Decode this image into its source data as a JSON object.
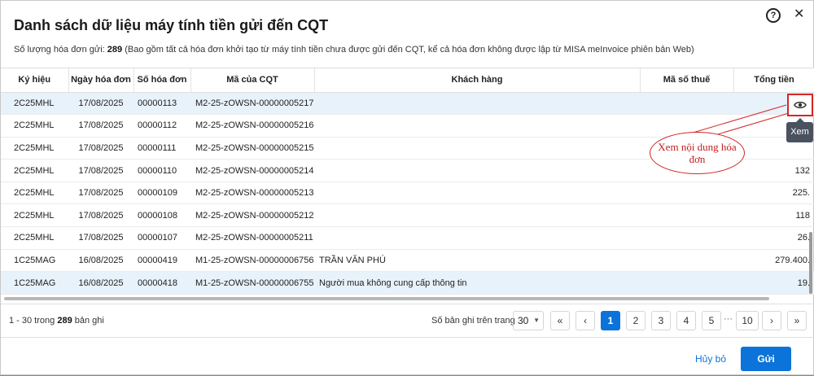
{
  "dialog": {
    "title": "Danh sách dữ liệu máy tính tiền gửi đến CQT",
    "help_icon_glyph": "?",
    "close_icon_glyph": "✕",
    "count_label": "Số lượng hóa đơn gửi: ",
    "count_value": "289",
    "count_note": " (Bao gồm tất cả hóa đơn khởi tạo từ máy tính tiền chưa được gửi đến CQT, kể cả hóa đơn không được lập từ MISA meInvoice phiên bản Web)"
  },
  "table": {
    "headers": [
      "Ký hiệu",
      "Ngày hóa đơn",
      "Số hóa đơn",
      "Mã của CQT",
      "Khách hàng",
      "Mã số thuế",
      "Tổng tiền"
    ],
    "rows": [
      {
        "ky_hieu": "2C25MHL",
        "ngay": "17/08/2025",
        "so": "00000113",
        "ma_cqt": "M2-25-zOWSN-00000005217",
        "khach_hang": "",
        "mst": "",
        "tong_tien": ""
      },
      {
        "ky_hieu": "2C25MHL",
        "ngay": "17/08/2025",
        "so": "00000112",
        "ma_cqt": "M2-25-zOWSN-00000005216",
        "khach_hang": "",
        "mst": "",
        "tong_tien": ""
      },
      {
        "ky_hieu": "2C25MHL",
        "ngay": "17/08/2025",
        "so": "00000111",
        "ma_cqt": "M2-25-zOWSN-00000005215",
        "khach_hang": "",
        "mst": "",
        "tong_tien": ""
      },
      {
        "ky_hieu": "2C25MHL",
        "ngay": "17/08/2025",
        "so": "00000110",
        "ma_cqt": "M2-25-zOWSN-00000005214",
        "khach_hang": "",
        "mst": "",
        "tong_tien": "132"
      },
      {
        "ky_hieu": "2C25MHL",
        "ngay": "17/08/2025",
        "so": "00000109",
        "ma_cqt": "M2-25-zOWSN-00000005213",
        "khach_hang": "",
        "mst": "",
        "tong_tien": "225."
      },
      {
        "ky_hieu": "2C25MHL",
        "ngay": "17/08/2025",
        "so": "00000108",
        "ma_cqt": "M2-25-zOWSN-00000005212",
        "khach_hang": "",
        "mst": "",
        "tong_tien": "118"
      },
      {
        "ky_hieu": "2C25MHL",
        "ngay": "17/08/2025",
        "so": "00000107",
        "ma_cqt": "M2-25-zOWSN-00000005211",
        "khach_hang": "",
        "mst": "",
        "tong_tien": "26."
      },
      {
        "ky_hieu": "1C25MAG",
        "ngay": "16/08/2025",
        "so": "00000419",
        "ma_cqt": "M1-25-zOWSN-00000006756",
        "khach_hang": "TRẦN VĂN PHÚ",
        "mst": "",
        "tong_tien": "279.400."
      },
      {
        "ky_hieu": "1C25MAG",
        "ngay": "16/08/2025",
        "so": "00000418",
        "ma_cqt": "M1-25-zOWSN-00000006755",
        "khach_hang": "Người mua không cung cấp thông tin",
        "mst": "",
        "tong_tien": "19."
      }
    ]
  },
  "row_action": {
    "icon": "eye-icon",
    "tooltip": "Xem"
  },
  "annotation": {
    "text": "Xem nội dung hóa đơn",
    "color": "#d32727"
  },
  "footer": {
    "range_prefix": "1 - 30 trong ",
    "range_total": "289",
    "range_suffix": " bản ghi",
    "per_page_label": "Số bản ghi trên trang",
    "per_page_value": "30",
    "first": "«",
    "prev": "‹",
    "pages": [
      "1",
      "2",
      "3",
      "4",
      "5"
    ],
    "ellipsis": "···",
    "last_page": "10",
    "next": "›",
    "last": "»"
  },
  "actions": {
    "cancel": "Hủy bỏ",
    "send": "Gửi"
  },
  "colors": {
    "accent": "#0b73d9",
    "selected_row": "#e8f2fb"
  }
}
